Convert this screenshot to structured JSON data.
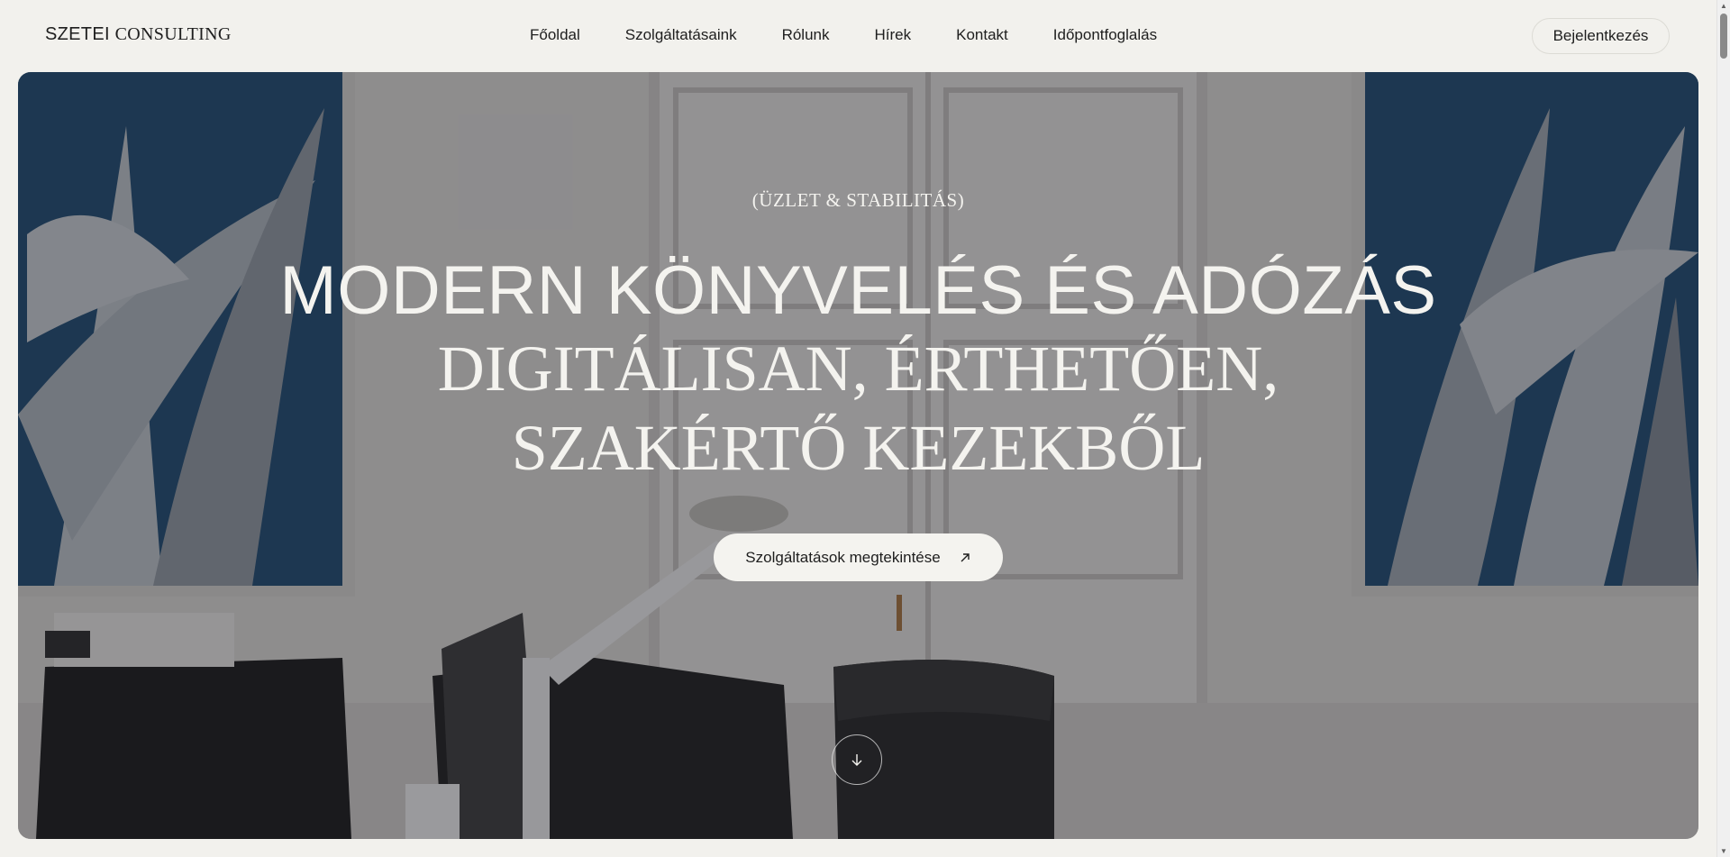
{
  "header": {
    "logo_primary": "SZETEI",
    "logo_secondary": "CONSULTING",
    "nav": [
      {
        "label": "Főoldal"
      },
      {
        "label": "Szolgáltatásaink"
      },
      {
        "label": "Rólunk"
      },
      {
        "label": "Hírek"
      },
      {
        "label": "Kontakt"
      },
      {
        "label": "Időpontfoglalás"
      }
    ],
    "login_label": "Bejelentkezés"
  },
  "hero": {
    "eyebrow": "(ÜZLET & STABILITÁS)",
    "headline": "MODERN KÖNYVELÉS ÉS ADÓZÁS",
    "subline_1": "DIGITÁLISAN, ÉRTHETŐEN,",
    "subline_2": "SZAKÉRTŐ KEZEKBŐL",
    "cta_label": "Szolgáltatások megtekintése",
    "cta_icon": "arrow-up-right-icon",
    "scroll_icon": "arrow-down-icon"
  },
  "colors": {
    "page_bg": "#f2f1ed",
    "text_dark": "#1e1e1e",
    "hero_text": "#f4f3ef",
    "wall_blue": "#1f4a6e"
  }
}
